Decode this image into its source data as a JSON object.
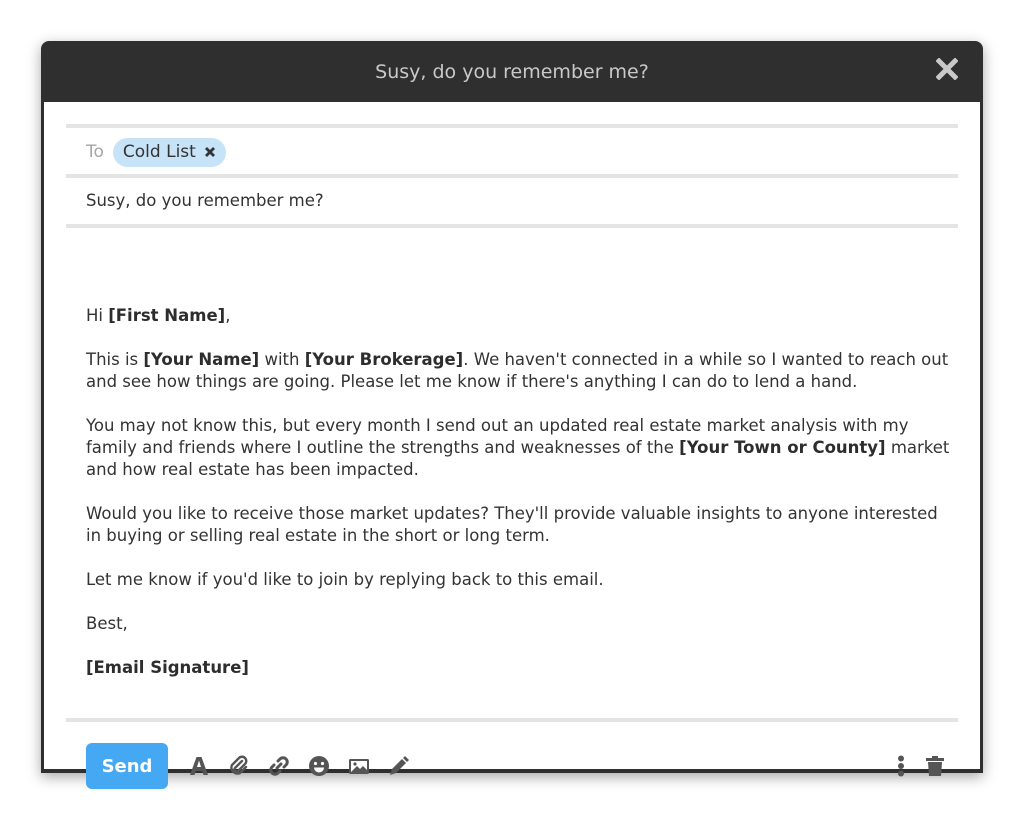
{
  "window": {
    "title": "Susy, do you remember me?",
    "close_icon": "close-icon"
  },
  "compose": {
    "to_label": "To",
    "recipients": [
      {
        "label": "Cold List",
        "remove_icon": "close-icon"
      }
    ],
    "subject": "Susy, do you remember me?",
    "body": {
      "greeting_pre": "Hi ",
      "greeting_bold": "[First Name]",
      "greeting_post": ",",
      "p1_a": "This is ",
      "p1_b": "[Your Name]",
      "p1_c": " with ",
      "p1_d": "[Your Brokerage]",
      "p1_e": ". We haven't connected in a while so I wanted to reach out and see how things are going. Please let me know if there's anything I can do to lend a hand.",
      "p2_a": "You may not know this, but every month I send out an updated real estate market analysis with my family and friends where I outline the strengths and weaknesses of the ",
      "p2_b": "[Your Town or County]",
      "p2_c": " market and how real estate has been impacted.",
      "p3": "Would you like to receive those market updates? They'll provide valuable insights to anyone interested in buying or selling real estate in the short or long term.",
      "p4": "Let me know if you'd like to join by replying back to this email.",
      "closing": "Best,",
      "signature": "[Email Signature]"
    }
  },
  "toolbar": {
    "send_label": "Send",
    "icons": [
      "text-format-icon",
      "attachment-icon",
      "link-icon",
      "emoji-icon",
      "image-icon",
      "pen-icon"
    ],
    "right_icons": [
      "more-options-icon",
      "trash-icon"
    ]
  },
  "colors": {
    "accent": "#44a8f2",
    "chip": "#c6e3f7",
    "titlebar": "#2f2f2f"
  }
}
